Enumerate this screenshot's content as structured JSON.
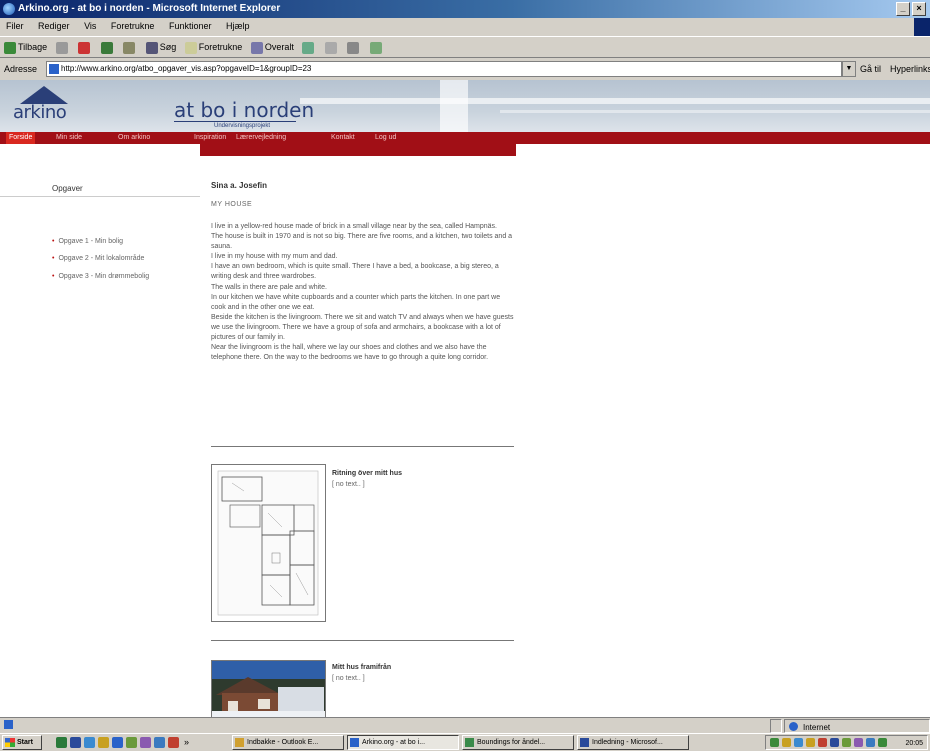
{
  "window": {
    "title": "Arkino.org - at bo i norden - Microsoft Internet Explorer",
    "minimize": "_",
    "close": "×"
  },
  "menu": [
    "Filer",
    "Rediger",
    "Vis",
    "Foretrukne",
    "Funktioner",
    "Hjælp"
  ],
  "toolbar": {
    "back": "Tilbage",
    "search": "Søg",
    "favorites": "Foretrukne",
    "media": "Overalt"
  },
  "address": {
    "label": "Adresse",
    "url": "http://www.arkino.org/atbo_opgaver_vis.asp?opgaveID=1&groupID=23",
    "go": "Gå til",
    "links": "Hyperlinks"
  },
  "site": {
    "logo": "arkino",
    "title": "at bo i norden",
    "subtitle": "Undervisningsprojekt",
    "nav": [
      "Forside",
      "Min side",
      "Om arkino",
      "Inspiration",
      "Lærervejledning",
      "Kontakt",
      "Log ud"
    ]
  },
  "sidebar": {
    "heading": "Opgaver",
    "items": [
      "Opgave 1 - Min bolig",
      "Opgave 2 - Mit lokalområde",
      "Opgave 3 - Min drømmebolig"
    ]
  },
  "content": {
    "author": "Sina a. Josefin",
    "subheading": "MY HOUSE",
    "paragraphs": [
      "I live in a yellow-red house made of brick in a small village near by the sea, called Hampnäs.",
      "The house is built in 1970 and is not so big. There are five rooms, and a kitchen, two toilets and a sauna.",
      "I live in my house with my mum and dad.",
      "I have an own bedroom, which is quite small. There I have a bed, a bookcase, a big stereo, a writing desk and three wardrobes.",
      "The walls in there are pale and white.",
      "In our kitchen we have white cupboards and a counter which parts the kitchen. In one part we cook and in the other one we eat.",
      "Beside the kitchen is the livingroom. There we sit and watch TV and always when we have guests we use the livingroom. There we have a group of sofa and armchairs, a bookcase with a lot of pictures of our family in.",
      "Near the livingroom is the hall, where we lay our shoes and clothes and we also have the telephone there. On the way to the bedrooms we have to go through a quite long corridor."
    ],
    "items": [
      {
        "title": "Ritning över mitt hus",
        "sub": "[ no text.. ]"
      },
      {
        "title": "Mitt hus framifrån",
        "sub": "[ no text.. ]"
      }
    ]
  },
  "status": {
    "zone": "Internet"
  },
  "taskbar": {
    "start": "Start",
    "tasks": [
      "Indbakke - Outlook E...",
      "Arkino.org - at bo i...",
      "Boundings for åndel...",
      "Indledning - Microsof..."
    ],
    "clock": "20:05"
  },
  "colors": {
    "nav_red": "#a10f16",
    "nav_active": "#d9281f",
    "brand_blue": "#2a3f78"
  }
}
